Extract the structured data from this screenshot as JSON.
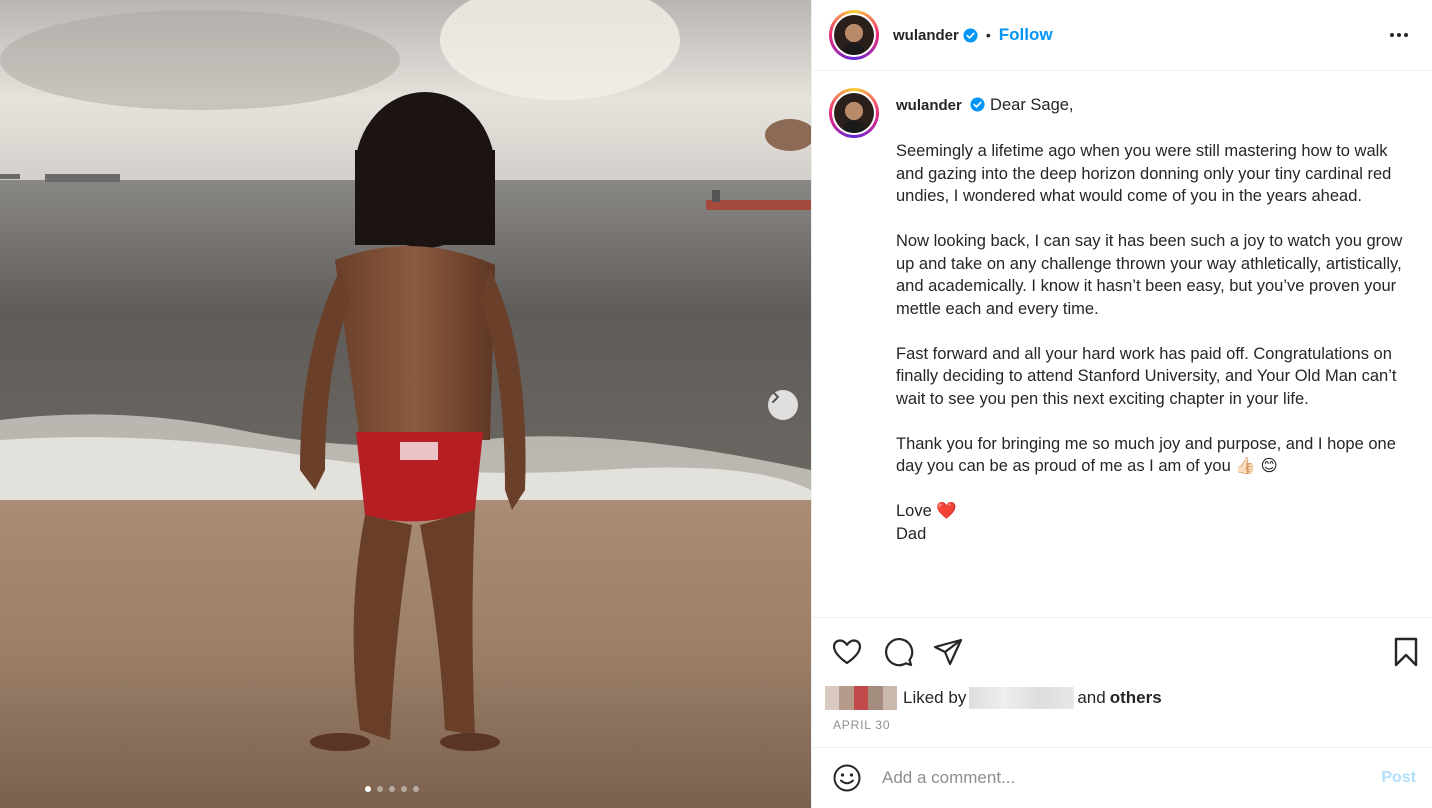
{
  "post": {
    "username": "wulander",
    "verified": true,
    "separator": "•",
    "follow_label": "Follow",
    "caption": {
      "greeting": "Dear Sage,",
      "paragraphs": [
        "Seemingly a lifetime ago when you were still mastering how to walk and gazing into the deep horizon donning only your tiny cardinal red undies, I wondered what would come of you in the years ahead.",
        "Now looking back, I can say it has been such a joy to watch you grow up and take on any challenge thrown your way athletically, artistically, and academically. I know it hasn’t been easy, but you’ve proven your mettle each and every time.",
        "Fast forward and all your hard work has paid off. Congratulations on finally deciding to attend Stanford University, and Your Old Man can’t wait to see you pen this next exciting chapter in your life.",
        "Thank you for bringing me so much joy and purpose, and I hope one day you can be as proud of me as I am of you 👍🏻 😊"
      ],
      "signoff_line1": "Love ❤️",
      "signoff_line2": "Dad"
    },
    "likes": {
      "prefix": "Liked by",
      "connector": "and",
      "others": "others"
    },
    "date": "APRIL 30",
    "comment": {
      "placeholder": "Add a comment...",
      "post_label": "Post"
    },
    "carousel": {
      "total_slides": 5,
      "active_slide": 1
    },
    "colors": {
      "follow": "#0095f6",
      "post_disabled": "#b2dffc",
      "heart": "#e0245e"
    }
  }
}
